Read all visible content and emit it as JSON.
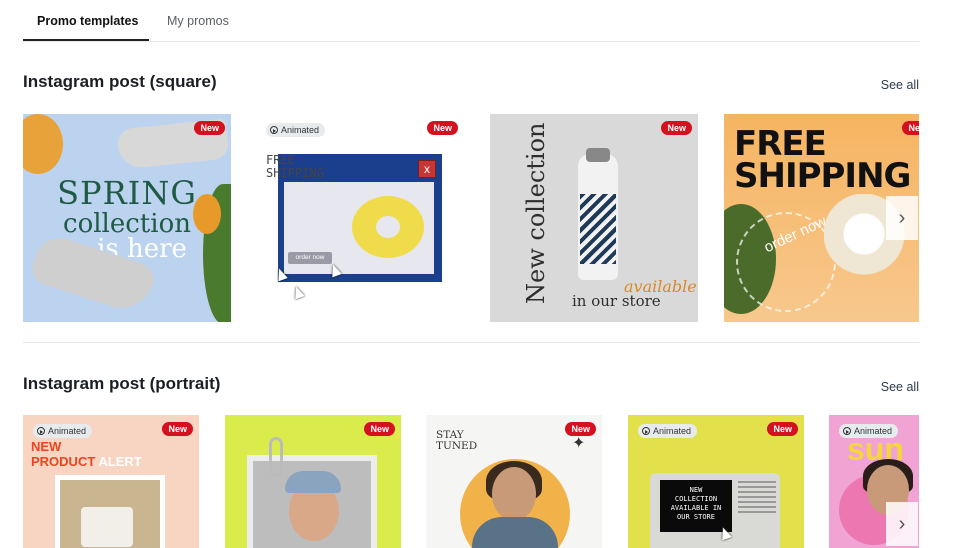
{
  "tabs": [
    {
      "label": "Promo templates",
      "active": true
    },
    {
      "label": "My promos",
      "active": false
    }
  ],
  "sections": {
    "square": {
      "title": "Instagram post (square)",
      "see_all": "See all",
      "cards": [
        {
          "badge": "New",
          "line1": "SPRING",
          "line2": "collection",
          "line3": "is here"
        },
        {
          "badge": "New",
          "animated": "Animated",
          "line1": "FREE",
          "line2": "SHIPPING",
          "button": "order now",
          "close": "x"
        },
        {
          "badge": "New",
          "vertical": "New collection",
          "available": "available",
          "store": "in our store"
        },
        {
          "badge": "New",
          "line1": "FREE",
          "line2": "SHIPPING",
          "ring": "order now"
        }
      ]
    },
    "portrait": {
      "title": "Instagram post (portrait)",
      "see_all": "See all",
      "cards": [
        {
          "badge": "New",
          "animated": "Animated",
          "line1": "NEW",
          "line2a": "PRODUCT",
          "line2b": "ALERT"
        },
        {
          "badge": "New"
        },
        {
          "badge": "New",
          "line1": "STAY",
          "line2": "TUNED"
        },
        {
          "badge": "New",
          "animated": "Animated",
          "screen1": "NEW",
          "screen2": "COLLECTION",
          "screen3": "AVAILABLE IN",
          "screen4": "OUR STORE"
        },
        {
          "animated": "Animated",
          "word": "sun"
        }
      ]
    }
  },
  "icons": {
    "next_arrow": "chevron-right-icon",
    "animated": "play-circle-icon"
  },
  "colors": {
    "badge_new": "#d4111f",
    "accent_text": "#2d3b4e"
  }
}
